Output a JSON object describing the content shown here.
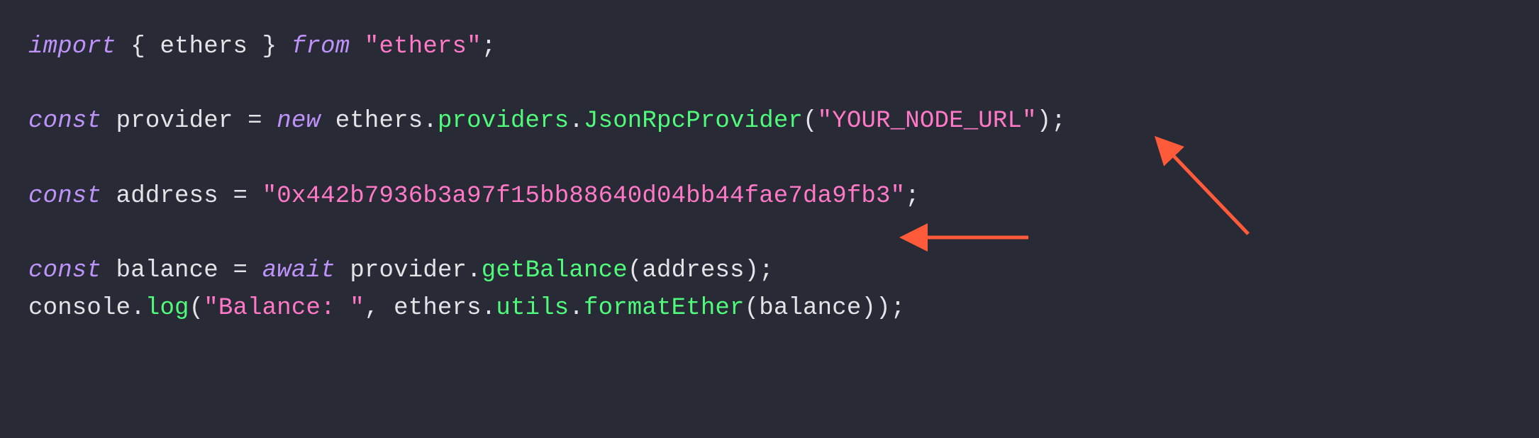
{
  "code": {
    "line1": {
      "kw_import": "import",
      "brace_open": " { ",
      "ethers": "ethers",
      "brace_close": " } ",
      "kw_from": "from",
      "space": " ",
      "str_ethers": "\"ethers\"",
      "semi": ";"
    },
    "line2": "",
    "line3": {
      "kw_const": "const",
      "sp1": " ",
      "provider": "provider",
      "eq": " = ",
      "kw_new": "new",
      "sp2": " ",
      "ethers": "ethers",
      "dot1": ".",
      "providers": "providers",
      "dot2": ".",
      "ctor": "JsonRpcProvider",
      "paren_o": "(",
      "str_url": "\"YOUR_NODE_URL\"",
      "paren_c": ")",
      "semi": ";"
    },
    "line4": "",
    "line5": {
      "kw_const": "const",
      "sp1": " ",
      "address": "address",
      "eq": " = ",
      "str_addr": "\"0x442b7936b3a97f15bb88640d04bb44fae7da9fb3\"",
      "semi": ";"
    },
    "line6": "",
    "line7": {
      "kw_const": "const",
      "sp1": " ",
      "balance": "balance",
      "eq": " = ",
      "kw_await": "await",
      "sp2": " ",
      "provider": "provider",
      "dot": ".",
      "getBalance": "getBalance",
      "paren_o": "(",
      "arg": "address",
      "paren_c": ")",
      "semi": ";"
    },
    "line8": {
      "console": "console",
      "dot1": ".",
      "log": "log",
      "paren_o": "(",
      "str_label": "\"Balance: \"",
      "comma": ", ",
      "ethers": "ethers",
      "dot2": ".",
      "utils": "utils",
      "dot3": ".",
      "formatEther": "formatEther",
      "paren_o2": "(",
      "arg": "balance",
      "paren_c2": ")",
      "paren_c": ")",
      "semi": ";"
    }
  },
  "annotations": {
    "arrow_color": "#ff5b3a"
  }
}
